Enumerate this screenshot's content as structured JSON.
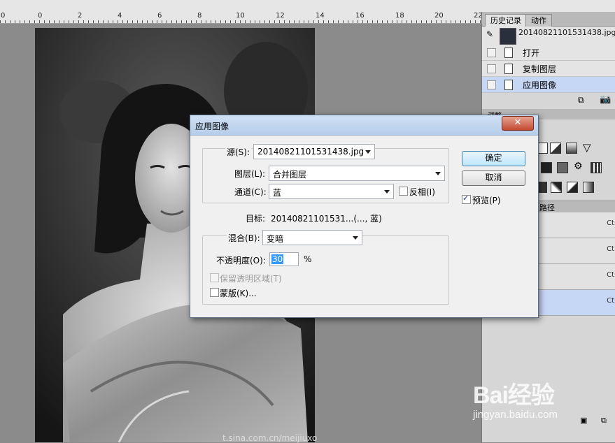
{
  "ruler": {
    "labels": [
      "0",
      "0",
      "2",
      "4",
      "6",
      "8",
      "10",
      "12",
      "14",
      "16",
      "18",
      "20",
      "22"
    ]
  },
  "history_panel": {
    "tabs": [
      "历史记录",
      "动作"
    ],
    "snapshot_name": "20140821101531438.jpg",
    "items": [
      "打开",
      "复制图层",
      "应用图像"
    ]
  },
  "adjust_panel": {
    "tab": "调整"
  },
  "paths_panel": {
    "tab": "路径",
    "shortcut": "Ct"
  },
  "dialog": {
    "title": "应用图像",
    "close": "✕",
    "source_label": "源(S):",
    "source_value": "20140821101531438.jpg",
    "layer_label": "图层(L):",
    "layer_value": "合并图层",
    "channel_label": "通道(C):",
    "channel_value": "蓝",
    "invert_label": "反相(I)",
    "target_label": "目标:",
    "target_value": "20140821101531...(..., 蓝)",
    "blend_label": "混合(B):",
    "blend_value": "变暗",
    "opacity_label": "不透明度(O):",
    "opacity_value": "30",
    "opacity_unit": "%",
    "preserve_label": "保留透明区域(T)",
    "mask_label": "蒙版(K)...",
    "ok_label": "确定",
    "cancel_label": "取消",
    "preview_label": "预览(P)"
  },
  "watermark": {
    "brand": "Bai经验",
    "url": "jingyan.baidu.com"
  },
  "credit": "t.sina.com.cn/meijiuxo"
}
